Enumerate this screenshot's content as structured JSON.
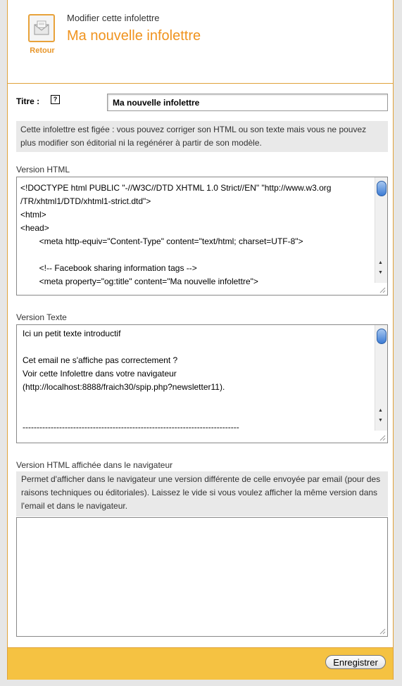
{
  "header": {
    "subtitle": "Modifier cette infolettre",
    "title": "Ma nouvelle infolettre",
    "back_label": "Retour"
  },
  "form": {
    "titre_label": "Titre :",
    "help_icon": "?",
    "titre_value": "Ma nouvelle infolettre",
    "frozen_note": "Cette infolettre est figée : vous pouvez corriger son HTML ou son texte mais vous ne pouvez plus modifier son éditorial ni la regénérer à partir de son modèle.",
    "html_label": "Version HTML",
    "html_content": "<!DOCTYPE html PUBLIC \"-//W3C//DTD XHTML 1.0 Strict//EN\" \"http://www.w3.org\n/TR/xhtml1/DTD/xhtml1-strict.dtd\">\n<html>\n<head>\n        <meta http-equiv=\"Content-Type\" content=\"text/html; charset=UTF-8\">\n\n        <!-- Facebook sharing information tags -->\n        <meta property=\"og:title\" content=\"Ma nouvelle infolettre\">",
    "text_label": "Version Texte",
    "text_content": "Ici un petit texte introductif\n\nCet email ne s'affiche pas correctement ?\nVoir cette Infolettre dans votre navigateur\n(http://localhost:8888/fraich30/spip.php?newsletter11).\n\n\n-----------------------------------------------------------------------------",
    "browser_label": "Version HTML affichée dans le navigateur",
    "browser_note": "Permet d'afficher dans le navigateur une version différente de celle envoyée par email (pour des raisons techniques ou éditoriales). Laissez le vide si vous voulez afficher la même version dans l'email et dans le navigateur.",
    "browser_content": ""
  },
  "footer": {
    "save_label": "Enregistrer"
  },
  "colors": {
    "accent": "#f0931e",
    "footer_bg": "#f5c242",
    "border": "#e0a23a"
  }
}
